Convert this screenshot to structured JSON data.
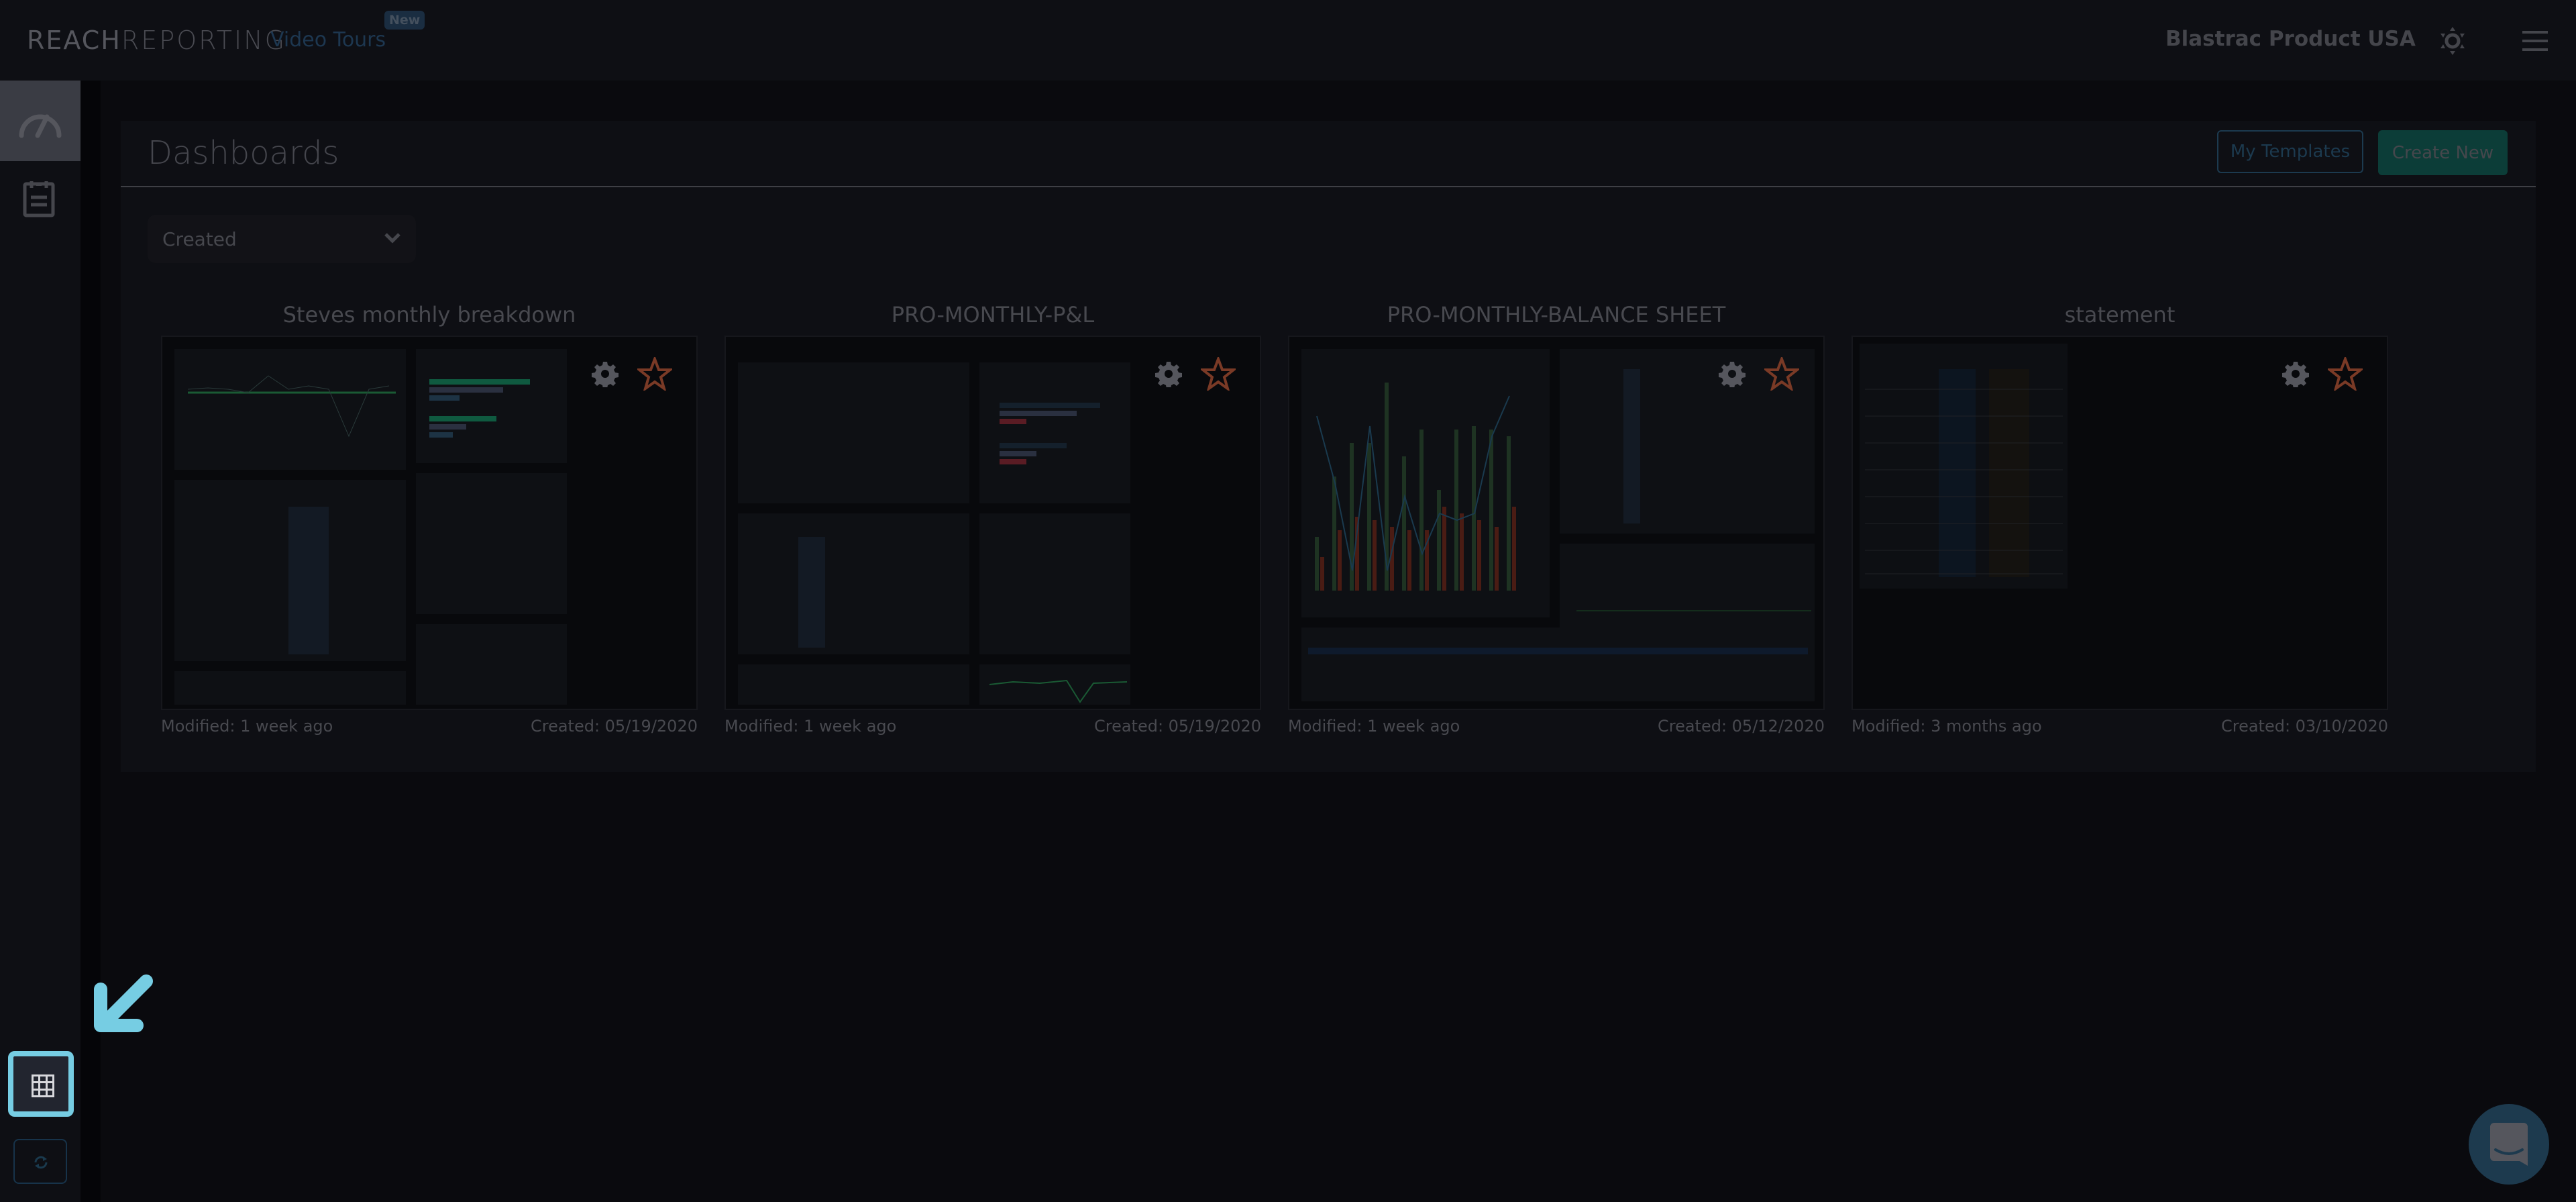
{
  "header": {
    "logo_bold": "REACH",
    "logo_thin": "REPORTING",
    "video_tours_label": "Video Tours",
    "new_badge": "New",
    "company_name": "Blastrac Product USA",
    "theme_icon": "sun-icon",
    "menu_icon": "hamburger-menu-icon"
  },
  "sidebar": {
    "items": [
      {
        "icon": "speedometer-icon",
        "label": "Dashboards",
        "active": true
      },
      {
        "icon": "clipboard-icon",
        "label": "Reports",
        "active": false
      }
    ],
    "bottom": [
      {
        "icon": "grid-icon",
        "highlighted": true
      },
      {
        "icon": "refresh-icon",
        "highlighted": false
      }
    ]
  },
  "main": {
    "title": "Dashboards",
    "buttons": {
      "my_templates": "My Templates",
      "create_new": "Create New"
    },
    "sort_filter": {
      "selected": "Created"
    },
    "dashboards": [
      {
        "title": "Steves monthly breakdown",
        "modified": "Modified: 1 week ago",
        "created": "Created: 05/19/2020",
        "favorite": false
      },
      {
        "title": "PRO-MONTHLY-P&L",
        "modified": "Modified: 1 week ago",
        "created": "Created: 05/19/2020",
        "favorite": false
      },
      {
        "title": "PRO-MONTHLY-BALANCE SHEET",
        "modified": "Modified: 1 week ago",
        "created": "Created: 05/12/2020",
        "favorite": false
      },
      {
        "title": "statement",
        "modified": "Modified: 3 months ago",
        "created": "Created: 03/10/2020",
        "favorite": false
      }
    ]
  },
  "chat_widget": {
    "icon": "chat-smile-icon"
  },
  "annotation": {
    "icon": "pointer-arrow-icon",
    "color": "#76cde3"
  },
  "colors": {
    "accent_highlight": "#76cde3",
    "create_button": "#0c3d38",
    "template_border": "#1c3a4f",
    "star_outline": "#7a3a26",
    "link": "#1d3750"
  }
}
